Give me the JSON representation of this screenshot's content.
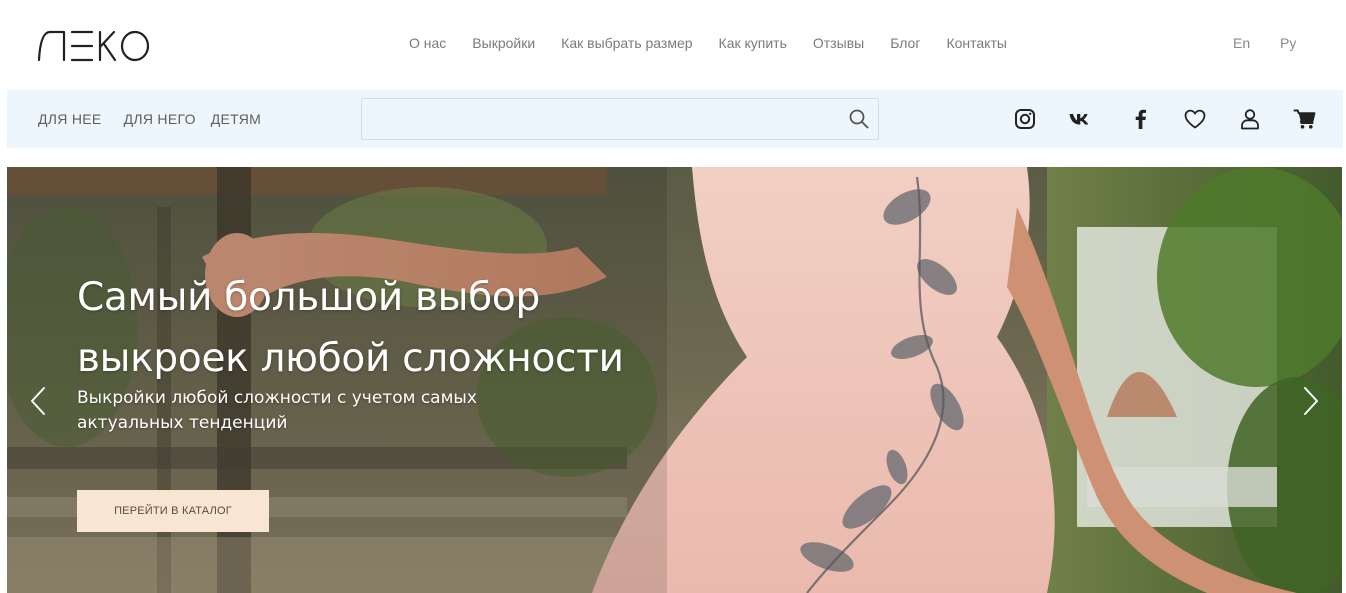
{
  "brand": {
    "logo_text": "ЛЕКО"
  },
  "nav": {
    "items": [
      {
        "label": "О нас"
      },
      {
        "label": "Выкройки"
      },
      {
        "label": "Как выбрать размер"
      },
      {
        "label": "Как купить"
      },
      {
        "label": "Отзывы"
      },
      {
        "label": "Блог"
      },
      {
        "label": "Контакты"
      }
    ]
  },
  "lang": {
    "en": "En",
    "ru": "Ру"
  },
  "categories": [
    {
      "label": "ДЛЯ НЕЕ"
    },
    {
      "label": "ДЛЯ НЕГО"
    },
    {
      "label": "ДЕТЯМ"
    }
  ],
  "search": {
    "placeholder": "",
    "value": ""
  },
  "icons": {
    "search": "search-icon",
    "instagram": "instagram-icon",
    "vk": "vk-icon",
    "facebook": "facebook-icon",
    "favorites": "heart-icon",
    "account": "user-icon",
    "cart": "cart-icon",
    "prev": "chevron-left-icon",
    "next": "chevron-right-icon"
  },
  "hero": {
    "title_line1": "Самый большой выбор",
    "title_line2": "выкроек любой сложности",
    "subtitle_line1": "Выкройки любой сложности с учетом самых",
    "subtitle_line2": "актуальных тенденций",
    "button_label": "ПЕРЕЙТИ В КАТАЛОГ"
  },
  "colors": {
    "subbar_bg": "#eef6fd",
    "button_bg": "#f8e6d2",
    "nav_text": "#7b7b7b",
    "hero_text": "#ffffff"
  }
}
